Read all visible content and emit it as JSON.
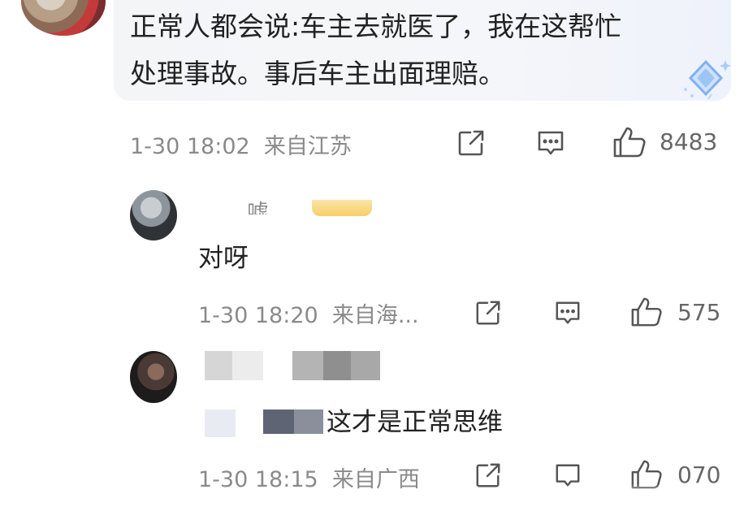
{
  "top_comment": {
    "text_line1": "正常人都会说:车主去就医了，我在这帮忙",
    "text_line2": "处理事故。事后车主出面理赔。",
    "timestamp": "1-30 18:02",
    "location": "来自江苏",
    "like_count": "8483"
  },
  "replies": [
    {
      "username": "… …嘘",
      "text": "对呀",
      "timestamp": "1-30 18:20",
      "location": "来自海...",
      "like_count": "575"
    },
    {
      "text": "这才是正常思维",
      "timestamp": "1-30 18:15",
      "location": "来自广西",
      "like_count": "070"
    }
  ],
  "icons": {
    "share": "share-icon",
    "comment": "comment-icon",
    "like": "thumbs-up-icon",
    "badge": "diamond-badge-icon"
  },
  "colors": {
    "meta_gray": "#8a8a8a",
    "text_dark": "#222222",
    "bubble_bg": "#f4f5f7",
    "badge_gold": "#f6cf66",
    "diamond_blue": "#7fb1f2"
  }
}
